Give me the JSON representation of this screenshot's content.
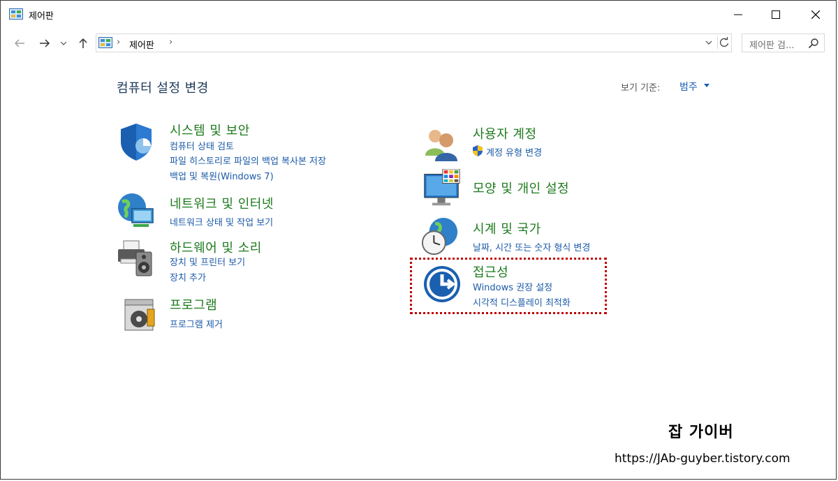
{
  "window": {
    "title": "제어판",
    "icon": "control-panel-icon"
  },
  "nav": {
    "breadcrumb": "제어판",
    "separator": "›",
    "search_placeholder": "제어판 검..."
  },
  "header": {
    "heading": "컴퓨터 설정 변경",
    "view_by_label": "보기 기준:",
    "view_by_value": "범주"
  },
  "categories": [
    {
      "icon": "shield-icon",
      "title": "시스템 및 보안",
      "links": [
        "컴퓨터 상태 검토",
        "파일 히스토리로 파일의 백업 복사본 저장",
        "백업 및 복원(Windows 7)"
      ]
    },
    {
      "icon": "network-globe-icon",
      "title": "네트워크 및 인터넷",
      "links": [
        "네트워크 상태 및 작업 보기"
      ]
    },
    {
      "icon": "printer-speaker-icon",
      "title": "하드웨어 및 소리",
      "links": [
        "장치 및 프린터 보기",
        "장치 추가"
      ]
    },
    {
      "icon": "program-disc-icon",
      "title": "프로그램",
      "links": [
        "프로그램 제거"
      ]
    },
    {
      "icon": "users-icon",
      "title": "사용자 계정",
      "links": [
        "계정 유형 변경"
      ]
    },
    {
      "icon": "monitor-palette-icon",
      "title": "모양 및 개인 설정",
      "links": []
    },
    {
      "icon": "clock-globe-icon",
      "title": "시계 및 국가",
      "links": [
        "날짜, 시간 또는 숫자 형식 변경"
      ]
    },
    {
      "icon": "accessibility-icon",
      "title": "접근성",
      "links": [
        "Windows 권장 설정",
        "시각적 디스플레이 최적화"
      ]
    }
  ],
  "watermark": {
    "title": "잡 가이버",
    "url": "https://JAb-guyber.tistory.com"
  },
  "colors": {
    "category_title": "#1d7a1d",
    "link": "#1c5ba8",
    "heading": "#1e395b",
    "highlight_border": "#c00000"
  }
}
